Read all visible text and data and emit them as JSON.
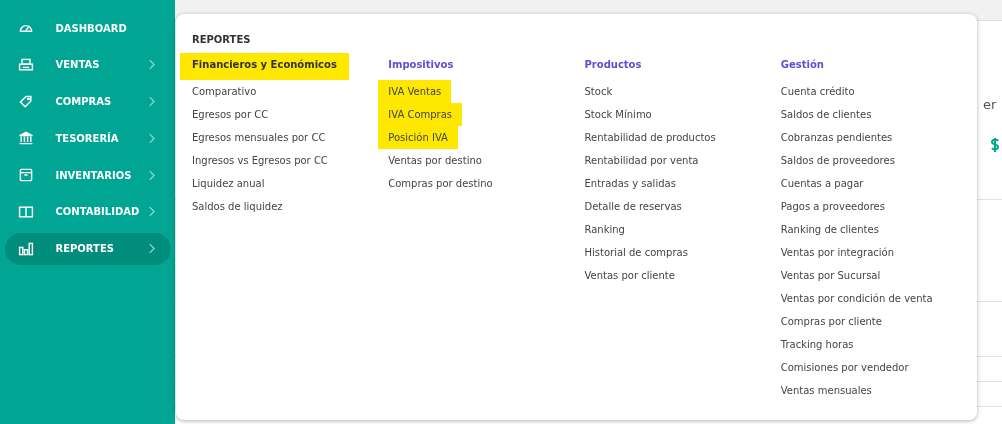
{
  "sidebar": {
    "items": [
      {
        "label": "DASHBOARD",
        "has_submenu": false,
        "selected": false
      },
      {
        "label": "VENTAS",
        "has_submenu": true,
        "selected": false
      },
      {
        "label": "COMPRAS",
        "has_submenu": true,
        "selected": false
      },
      {
        "label": "TESORERÍA",
        "has_submenu": true,
        "selected": false
      },
      {
        "label": "INVENTARIOS",
        "has_submenu": true,
        "selected": false
      },
      {
        "label": "CONTABILIDAD",
        "has_submenu": true,
        "selected": false
      },
      {
        "label": "REPORTES",
        "has_submenu": true,
        "selected": true
      }
    ]
  },
  "background": {
    "partial_text": "er"
  },
  "menu": {
    "title": "REPORTES",
    "columns": [
      {
        "heading": "Financieros y Económicos",
        "heading_highlighted": true,
        "items": [
          {
            "label": "Comparativo",
            "highlighted": false
          },
          {
            "label": "Egresos por CC",
            "highlighted": false
          },
          {
            "label": "Egresos mensuales por CC",
            "highlighted": false
          },
          {
            "label": "Ingresos vs Egresos por CC",
            "highlighted": false
          },
          {
            "label": "Liquidez anual",
            "highlighted": false
          },
          {
            "label": "Saldos de liquidez",
            "highlighted": false
          }
        ]
      },
      {
        "heading": "Impositivos",
        "heading_highlighted": false,
        "items": [
          {
            "label": "IVA Ventas",
            "highlighted": true
          },
          {
            "label": "IVA Compras",
            "highlighted": true
          },
          {
            "label": "Posición IVA",
            "highlighted": true
          },
          {
            "label": "Ventas por destino",
            "highlighted": false
          },
          {
            "label": "Compras por destino",
            "highlighted": false
          }
        ]
      },
      {
        "heading": "Productos",
        "heading_highlighted": false,
        "items": [
          {
            "label": "Stock",
            "highlighted": false
          },
          {
            "label": "Stock Mínimo",
            "highlighted": false
          },
          {
            "label": "Rentabilidad de productos",
            "highlighted": false
          },
          {
            "label": "Rentabilidad por venta",
            "highlighted": false
          },
          {
            "label": "Entradas y salidas",
            "highlighted": false
          },
          {
            "label": "Detalle de reservas",
            "highlighted": false
          },
          {
            "label": "Ranking",
            "highlighted": false
          },
          {
            "label": "Historial de compras",
            "highlighted": false
          },
          {
            "label": "Ventas por cliente",
            "highlighted": false
          }
        ]
      },
      {
        "heading": "Gestión",
        "heading_highlighted": false,
        "items": [
          {
            "label": "Cuenta crédito",
            "highlighted": false
          },
          {
            "label": "Saldos de clientes",
            "highlighted": false
          },
          {
            "label": "Cobranzas pendientes",
            "highlighted": false
          },
          {
            "label": "Saldos de proveedores",
            "highlighted": false
          },
          {
            "label": "Cuentas a pagar",
            "highlighted": false
          },
          {
            "label": "Pagos a proveedores",
            "highlighted": false
          },
          {
            "label": "Ranking de clientes",
            "highlighted": false
          },
          {
            "label": "Ventas por integración",
            "highlighted": false
          },
          {
            "label": "Ventas por Sucursal",
            "highlighted": false
          },
          {
            "label": "Ventas por condición de venta",
            "highlighted": false
          },
          {
            "label": "Compras por cliente",
            "highlighted": false
          },
          {
            "label": "Tracking horas",
            "highlighted": false
          },
          {
            "label": "Comisiones por vendedor",
            "highlighted": false
          },
          {
            "label": "Ventas mensuales",
            "highlighted": false
          }
        ]
      }
    ]
  }
}
